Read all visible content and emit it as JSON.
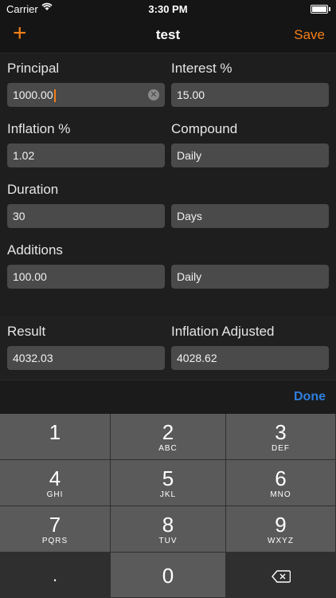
{
  "status_bar": {
    "carrier": "Carrier",
    "time": "3:30 PM"
  },
  "nav": {
    "add_label": "+",
    "title": "test",
    "save_label": "Save"
  },
  "form": {
    "principal": {
      "label": "Principal",
      "value": "1000.00"
    },
    "interest": {
      "label": "Interest %",
      "value": "15.00"
    },
    "inflation": {
      "label": "Inflation %",
      "value": "1.02"
    },
    "compound": {
      "label": "Compound",
      "value": "Daily"
    },
    "duration": {
      "label": "Duration",
      "value": "30",
      "unit": "Days"
    },
    "additions": {
      "label": "Additions",
      "value": "100.00",
      "frequency": "Daily"
    }
  },
  "result": {
    "result_label": "Result",
    "result_value": "4032.03",
    "inflation_label": "Inflation Adjusted",
    "inflation_value": "4028.62"
  },
  "accessory": {
    "done_label": "Done"
  },
  "keyboard": {
    "keys": [
      {
        "num": "1",
        "letters": ""
      },
      {
        "num": "2",
        "letters": "ABC"
      },
      {
        "num": "3",
        "letters": "DEF"
      },
      {
        "num": "4",
        "letters": "GHI"
      },
      {
        "num": "5",
        "letters": "JKL"
      },
      {
        "num": "6",
        "letters": "MNO"
      },
      {
        "num": "7",
        "letters": "PQRS"
      },
      {
        "num": "8",
        "letters": "TUV"
      },
      {
        "num": "9",
        "letters": "WXYZ"
      },
      {
        "num": ".",
        "letters": ""
      },
      {
        "num": "0",
        "letters": ""
      }
    ]
  },
  "colors": {
    "accent": "#f57f17",
    "done": "#2f7fde",
    "field": "#4a4a4a",
    "background": "#1c1c1c"
  },
  "icons": {
    "wifi": "wifi-icon",
    "battery": "battery-icon",
    "clear": "clear-icon",
    "backspace": "backspace-icon"
  }
}
